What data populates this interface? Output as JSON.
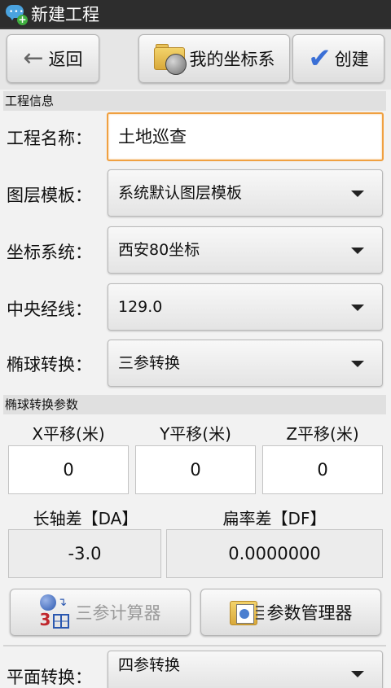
{
  "window": {
    "title": "新建工程"
  },
  "toolbar": {
    "back_label": "返回",
    "coord_label": "我的坐标系",
    "create_label": "创建"
  },
  "sections": {
    "project_info": "工程信息",
    "ellipsoid_params": "椭球转换参数"
  },
  "form": {
    "project_name": {
      "label": "工程名称：",
      "value": "土地巡查"
    },
    "layer_template": {
      "label": "图层模板：",
      "value": "系统默认图层模板"
    },
    "coord_system": {
      "label": "坐标系统：",
      "value": "西安80坐标"
    },
    "central_meridian": {
      "label": "中央经线：",
      "value": "129.0"
    },
    "ellipsoid_transform": {
      "label": "椭球转换：",
      "value": "三参转换"
    },
    "plane_transform": {
      "label": "平面转换：",
      "value": "四参转换"
    }
  },
  "params": {
    "x_shift": {
      "label": "X平移(米)",
      "value": "0"
    },
    "y_shift": {
      "label": "Y平移(米)",
      "value": "0"
    },
    "z_shift": {
      "label": "Z平移(米)",
      "value": "0"
    },
    "da": {
      "label": "长轴差【DA】",
      "value": "-3.0"
    },
    "df": {
      "label": "扁率差【DF】",
      "value": "0.0000000"
    }
  },
  "buttons": {
    "calc_label": "三参计算器",
    "param_mgr_label": "参数管理器"
  },
  "colors": {
    "titlebar": "#2d2d2d",
    "focus_border": "#f0a040",
    "disabled_text": "#9a9a9a"
  }
}
